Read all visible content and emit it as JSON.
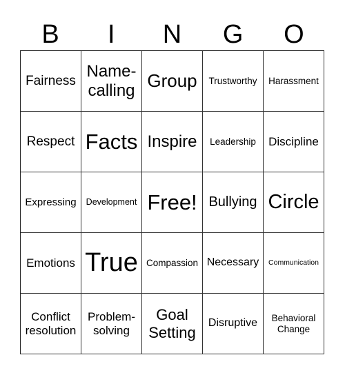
{
  "header": [
    "B",
    "I",
    "N",
    "G",
    "O"
  ],
  "cells": [
    "Fairness",
    "Name-calling",
    "Group",
    "Trustworthy",
    "Harassment",
    "Respect",
    "Facts",
    "Inspire",
    "Leadership",
    "Discipline",
    "Expressing",
    "Development",
    "Free!",
    "Bullying",
    "Circle",
    "Emotions",
    "True",
    "Compassion",
    "Necessary",
    "Communication",
    "Conflict resolution",
    "Problem-solving",
    "Goal Setting",
    "Disruptive",
    "Behavioral Change"
  ]
}
